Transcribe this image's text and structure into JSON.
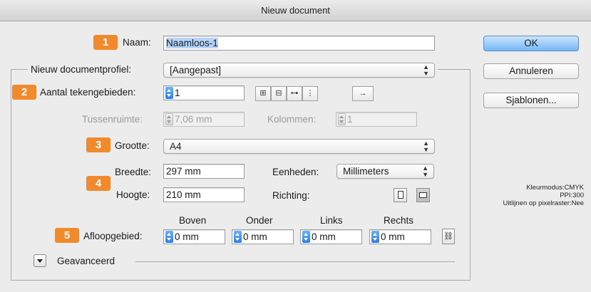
{
  "window": {
    "title": "Nieuw document"
  },
  "badges": [
    "1",
    "2",
    "3",
    "4",
    "5"
  ],
  "name": {
    "label": "Naam:",
    "value": "Naamloos-1"
  },
  "profile": {
    "label": "Nieuw documentprofiel:",
    "value": "[Aangepast]"
  },
  "artboards": {
    "label": "Aantal tekengebieden:",
    "value": "1"
  },
  "spacing": {
    "label": "Tussenruimte:",
    "value": "7,06 mm"
  },
  "columns": {
    "label": "Kolommen:",
    "value": "1"
  },
  "size": {
    "label": "Grootte:",
    "value": "A4"
  },
  "width": {
    "label": "Breedte:",
    "value": "297 mm"
  },
  "height": {
    "label": "Hoogte:",
    "value": "210 mm"
  },
  "units": {
    "label": "Eenheden:",
    "value": "Millimeters"
  },
  "orientation": {
    "label": "Richting:",
    "selected": "landscape"
  },
  "bleed": {
    "label": "Afloopgebied:",
    "headers": [
      "Boven",
      "Onder",
      "Links",
      "Rechts"
    ],
    "values": [
      "0 mm",
      "0 mm",
      "0 mm",
      "0 mm"
    ]
  },
  "advanced": {
    "label": "Geavanceerd"
  },
  "buttons": {
    "ok": "OK",
    "cancel": "Annuleren",
    "templates": "Sjablonen..."
  },
  "info": {
    "color_mode": "Kleurmodus:CMYK",
    "ppi": "PPI:300",
    "pixel_grid": "Uitlijnen op pixelraster:Nee"
  },
  "colors": {
    "badge": "#f08a2c",
    "default_button": "#74b6f6",
    "selection": "#b5d5ff"
  },
  "icons": [
    "grid-by-row-icon",
    "grid-by-column-icon",
    "arrange-by-row-icon",
    "arrange-by-column-icon",
    "right-to-left-icon",
    "portrait-icon",
    "landscape-icon",
    "link-icon",
    "disclosure-triangle-icon"
  ]
}
